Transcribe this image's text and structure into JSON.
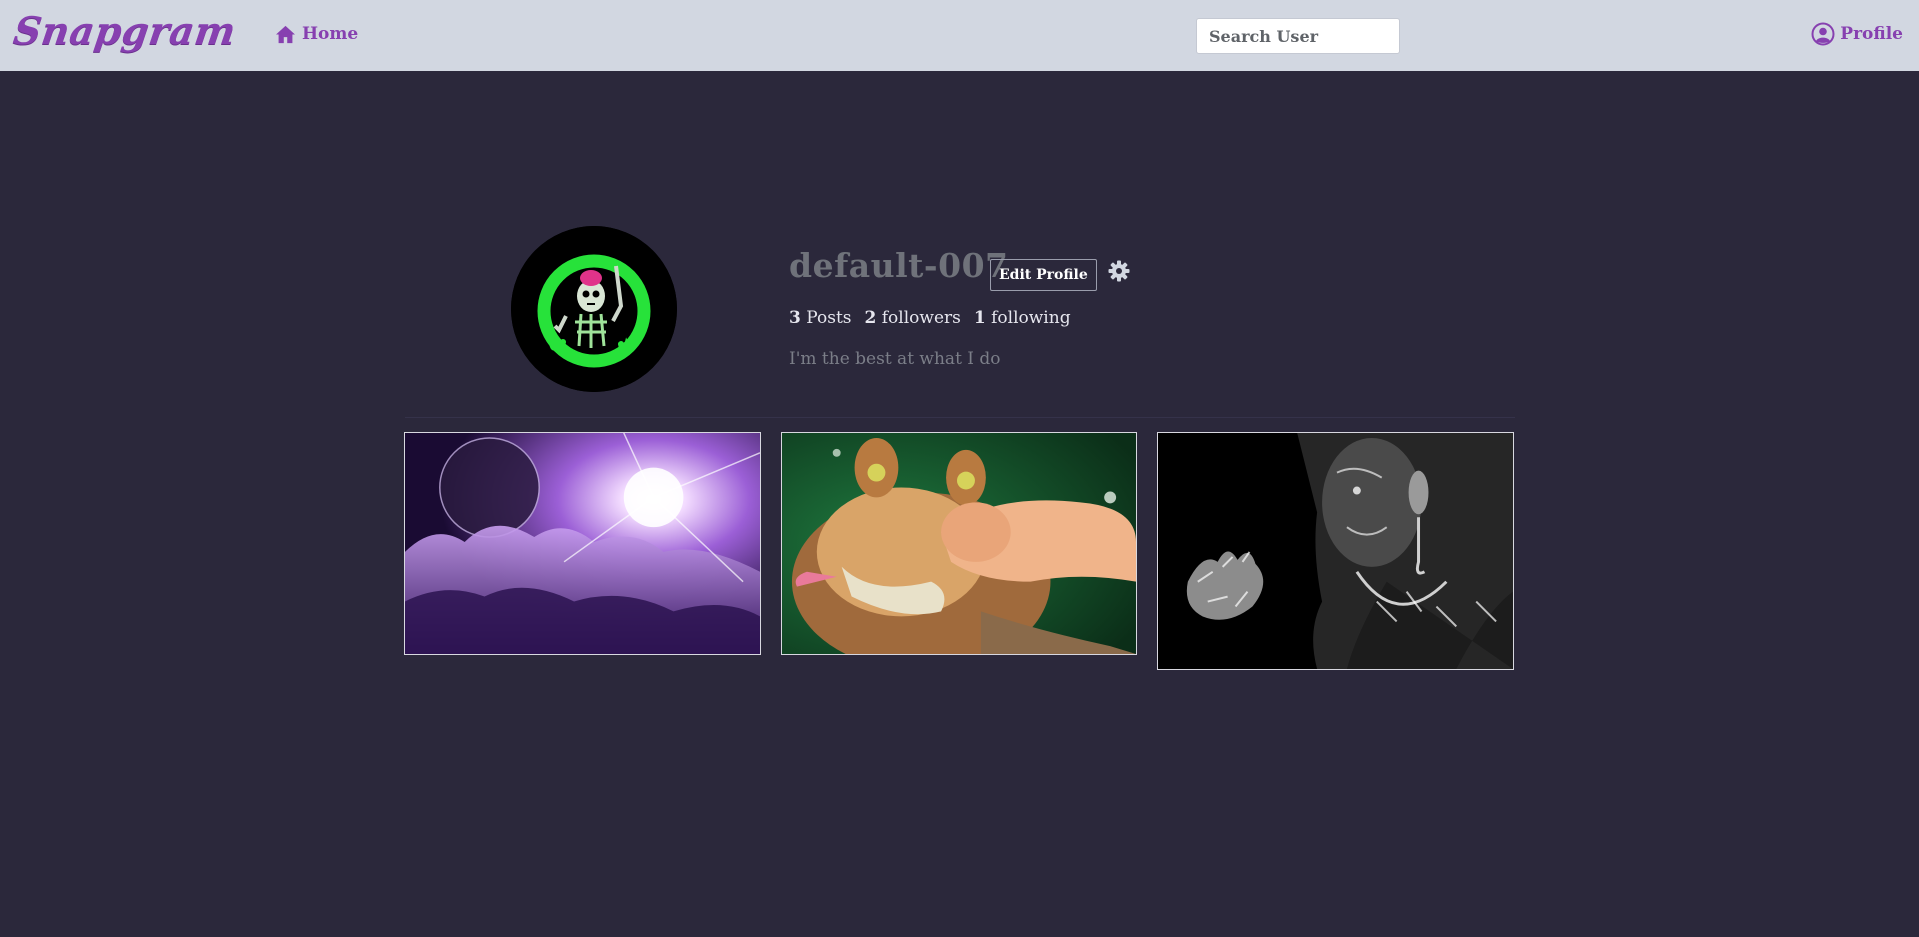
{
  "navbar": {
    "brand": "Snapgram",
    "home_label": "Home",
    "home_icon": "home-icon",
    "search_placeholder": "Search User",
    "profile_label": "Profile",
    "profile_icon": "user-circle-icon",
    "accent_color": "#8740b0",
    "background_color": "#d2d7e1"
  },
  "profile": {
    "username": "default-007",
    "edit_button_label": "Edit Profile",
    "settings_icon": "gear-icon",
    "stats": {
      "posts_count": "3",
      "posts_label": "Posts",
      "followers_count": "2",
      "followers_label": "followers",
      "following_count": "1",
      "following_label": "following"
    },
    "bio": "I'm the best at what I do"
  },
  "posts": [
    {
      "subject": "purple cosmic clouds with moon and bright star"
    },
    {
      "subject": "cartoon creature being punched by a fist"
    },
    {
      "subject": "black and white portrait of woman with painted skin"
    }
  ],
  "theme": {
    "page_background": "#2b283b"
  }
}
